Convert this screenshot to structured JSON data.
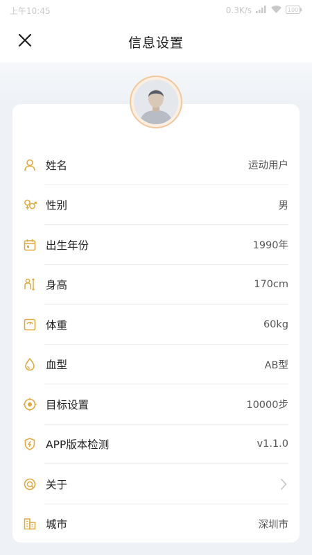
{
  "status_bar": {
    "time": "上午10:45",
    "network": "0.3K/s",
    "battery": "100"
  },
  "header": {
    "title": "信息设置"
  },
  "icons": {
    "close": "close-icon",
    "accent": "#e0a93c"
  },
  "items": [
    {
      "label": "姓名",
      "value": "运动用户",
      "icon": "person-icon"
    },
    {
      "label": "性别",
      "value": "男",
      "icon": "gender-icon"
    },
    {
      "label": "出生年份",
      "value": "1990年",
      "icon": "calendar-icon"
    },
    {
      "label": "身高",
      "value": "170cm",
      "icon": "height-icon"
    },
    {
      "label": "体重",
      "value": "60kg",
      "icon": "scale-icon"
    },
    {
      "label": "血型",
      "value": "AB型",
      "icon": "blood-drop-icon"
    },
    {
      "label": "目标设置",
      "value": "10000步",
      "icon": "target-icon"
    },
    {
      "label": "APP版本检测",
      "value": "v1.1.0",
      "icon": "shield-icon"
    },
    {
      "label": "关于",
      "value": "",
      "icon": "info-icon"
    },
    {
      "label": "城市",
      "value": "深圳市",
      "icon": "city-icon"
    }
  ]
}
